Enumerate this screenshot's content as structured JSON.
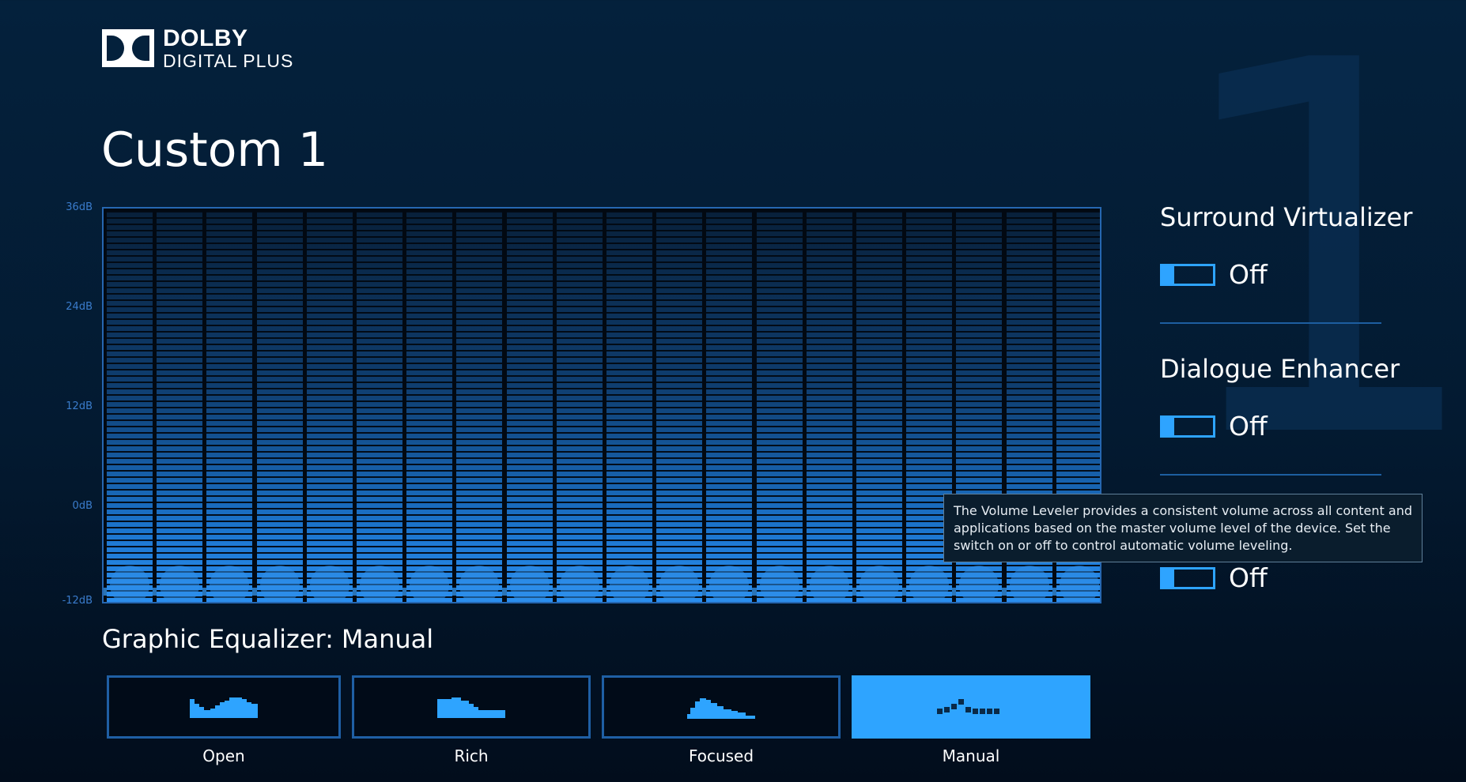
{
  "logo": {
    "line1": "DOLBY",
    "line2": "DIGITAL PLUS"
  },
  "profile": {
    "title": "Custom 1",
    "watermark_number": "1"
  },
  "equalizer": {
    "db_labels": [
      "36dB",
      "24dB",
      "12dB",
      "0dB",
      "-12dB"
    ],
    "band_count": 20,
    "label": "Graphic Equalizer:",
    "mode": "Manual",
    "presets": [
      {
        "label": "Open",
        "icon": "open-curve-icon",
        "selected": false
      },
      {
        "label": "Rich",
        "icon": "rich-curve-icon",
        "selected": false
      },
      {
        "label": "Focused",
        "icon": "focused-curve-icon",
        "selected": false
      },
      {
        "label": "Manual",
        "icon": "manual-dots-icon",
        "selected": true
      }
    ]
  },
  "settings": {
    "surround_virtualizer": {
      "label": "Surround Virtualizer",
      "state": "Off"
    },
    "dialogue_enhancer": {
      "label": "Dialogue Enhancer",
      "state": "Off"
    },
    "volume_leveler": {
      "state": "Off"
    }
  },
  "tooltip": {
    "text": "The Volume Leveler provides a consistent volume across all content and applications based on the master volume level of the device. Set the switch on or off to control automatic volume leveling."
  },
  "colors": {
    "accent": "#2ea4ff",
    "background": "#04213c",
    "border": "#2667b1"
  }
}
